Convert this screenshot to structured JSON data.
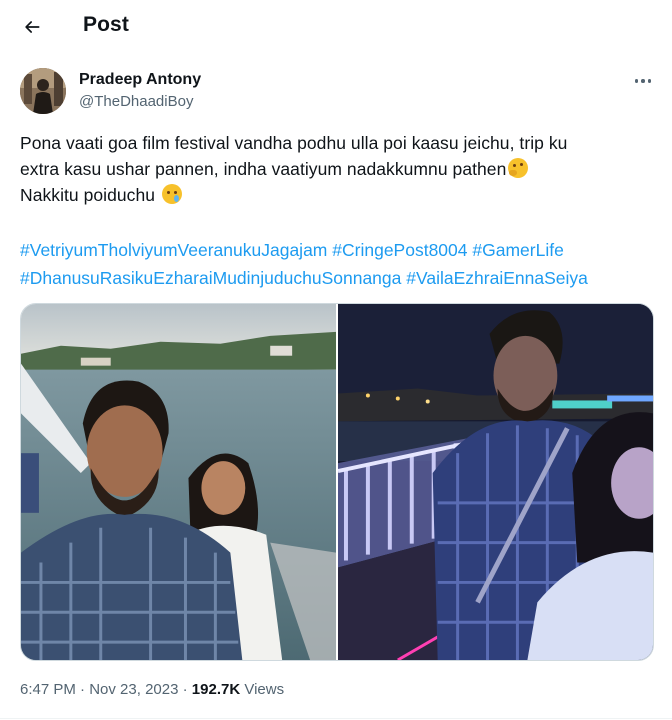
{
  "header": {
    "back_icon": "arrow-left-icon",
    "title": "Post"
  },
  "author": {
    "name": "Pradeep Antony",
    "handle": "@TheDhaadiBoy",
    "more_icon": "more-horizontal-icon"
  },
  "tweet": {
    "lines": [
      "Pona vaati goa film festival vandha podhu ulla poi kaasu jeichu, trip ku",
      "extra kasu ushar pannen, indha vaatiyum nadakkumnu pathen",
      "Nakkitu poiduchu"
    ],
    "emojis": [
      "thinking-face-emoji",
      "crying-face-emoji"
    ],
    "hashtags": [
      "#VetriyumTholviyumVeeranukuJagajam",
      "#CringePost8004",
      "#GamerLife",
      "#DhanusuRasikuEzharaiMudinjuduchuSonnanga",
      "#VailaEzhraiEnnaSeiya"
    ]
  },
  "media": {
    "photos": [
      "selfie-on-boat-daytime",
      "selfie-on-boat-night"
    ]
  },
  "meta": {
    "time": "6:47 PM",
    "separator": "·",
    "date": "Nov 23, 2023",
    "views_count": "192.7K",
    "views_label": "Views"
  },
  "colors": {
    "link": "#1d9bf0",
    "secondary_text": "#536471",
    "primary_text": "#0f1419"
  }
}
